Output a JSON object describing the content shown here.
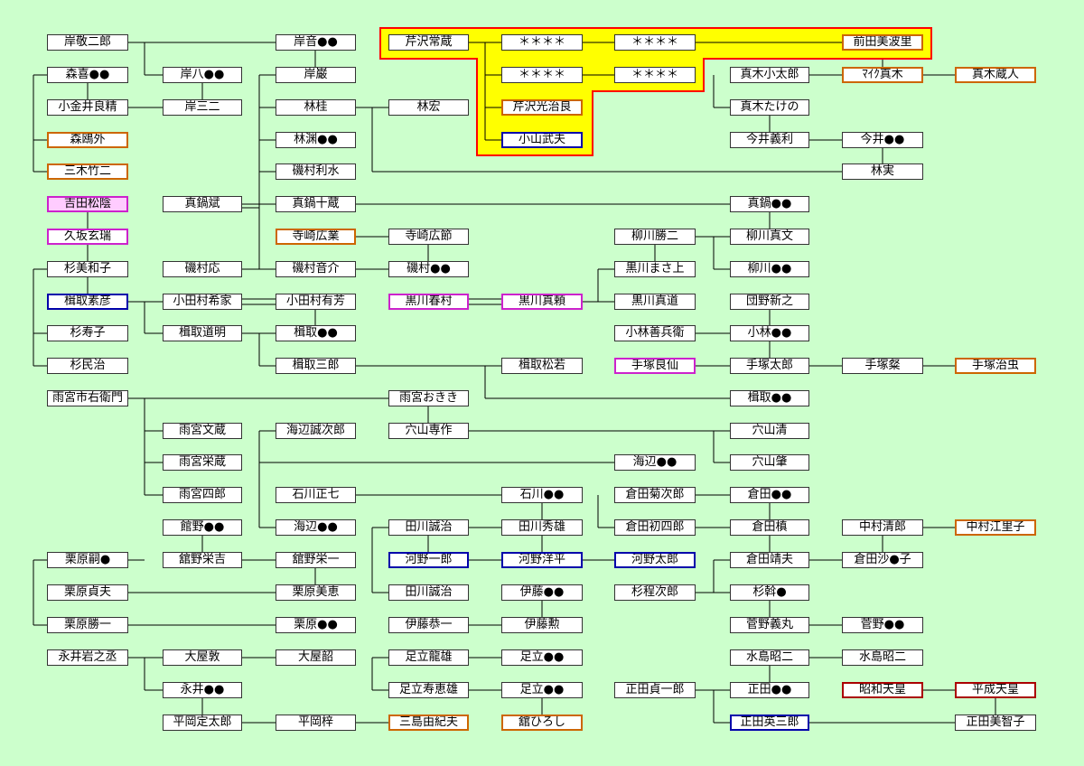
{
  "colors": {
    "background": "#ccffcc",
    "highlight_fill": "#ffff00",
    "highlight_border": "#ff0000",
    "orange_border": "#cc6600",
    "blue_border": "#0000aa",
    "pink_border": "#cc22cc",
    "red_border": "#aa0000",
    "pink_fill": "#ffccff"
  },
  "people": {
    "kishi_keijiro": "岸敬二郎",
    "kishi_a": "岸音●●",
    "kishi_gan": "岸巌",
    "kishi_hachi": "岸八●●",
    "kishi_sanji": "岸三二",
    "mori_ki": "森喜●●",
    "kogai_yoshikiyo": "小金井良精",
    "mori_ogai": "森鴎外",
    "miki_takeji": "三木竹二",
    "yoshida_shoin": "吉田松陰",
    "kusaka_genzui": "久坂玄瑞",
    "sugi_miwako": "杉美和子",
    "katori_motohiko": "楫取素彦",
    "sugi_hisako": "杉寿子",
    "sugi_minji": "杉民治",
    "odamura_kiyoie": "小田村希家",
    "katori_doumei": "楫取道明",
    "manabe_takeshi": "真鍋斌",
    "isomura_o": "磯村応",
    "hayashi_kei": "林桂",
    "hayashi_hiroshi": "林宏",
    "hayashi_x": "林渊●●",
    "isomura_risui": "磯村利水",
    "manabe_jyuzo": "真鍋十蔵",
    "terasaki_hironari": "寺崎広業",
    "terasaki_hirosetsu": "寺崎広節",
    "isomura_onsuke": "磯村音介",
    "isomura_x": "磯村●●",
    "odamura_arichika": "小田村有芳",
    "katori_x": "楫取●●",
    "katori_saburo": "楫取三郎",
    "serizawa_tsunezo": "芹沢常蔵",
    "stars": "＊＊＊＊",
    "maeda_minori": "前田美波里",
    "serizawa_mitsuharu": "芹沢光治良",
    "koyama_takeo": "小山武夫",
    "maki_kotaro": "真木小太郎",
    "mike_maki": "ﾏｲｸ真木",
    "maki_kurando": "真木蔵人",
    "maki_takeno": "真木たけの",
    "imai_yoshitoshi": "今井義利",
    "imai_x": "今井●●",
    "hayashi_minoru": "林実",
    "manabe_x": "真鍋●●",
    "yanagawa_katsuji": "柳川勝二",
    "yanagawa_masafumi": "柳川真文",
    "kurokawa_x": "黒川まさ上",
    "yanagawa_x": "柳川●●",
    "kurokawa_harumura": "黒川春村",
    "kurokawa_masayori": "黒川真頼",
    "kurokawa_mamichi": "黒川真道",
    "danno_shinnosuke": "団野新之",
    "kobayashi_zenbee": "小林善兵衛",
    "kobayashi_x": "小林●●",
    "tezuka_ryosen": "手塚良仙",
    "tezuka_taro": "手塚太郎",
    "tezuka_yutaka": "手塚粲",
    "tezuka_osamu": "手塚治虫",
    "katori_matsuwaka": "楫取松若",
    "katori_y": "楫取●●",
    "amamiya_ichiuemon": "雨宮市右衛門",
    "amamiya_ok": "雨宮おきき",
    "amamiya_bunzo": "雨宮文蔵",
    "amamiya_eizo": "雨宮栄蔵",
    "amamiya_shiro": "雨宮四郎",
    "unabe_seijiro": "海辺誠次郎",
    "anayama_sensaku": "穴山専作",
    "anayama_kiyoshi": "穴山清",
    "unabe_x": "海辺●●",
    "anayama_hajime": "穴山肇",
    "ishikawa_masashichi": "石川正七",
    "ishikawa_x": "石川●●",
    "kurata_kikujiro": "倉田菊次郎",
    "kurata_x": "倉田●●",
    "tateno_x": "館野●●",
    "unabe_y": "海辺●●",
    "tagawa_seiji": "田川誠治",
    "tagawa_hideo": "田川秀雄",
    "kurata_hatsushiro": "倉田初四郎",
    "kurata_shin": "倉田槙",
    "nakamura_kiyoshiro": "中村清郎",
    "nakamura_eriko": "中村江里子",
    "kurihara_x": "栗原嗣●",
    "tateno_eikichi": "舘野栄吉",
    "tateno_eiichi": "舘野栄一",
    "kono_ichiro": "河野一郎",
    "kono_yohei": "河野洋平",
    "kono_taro": "河野太郎",
    "kurata_yasuo": "倉田靖夫",
    "kurata_y": "倉田沙●子",
    "kurihara_sadao": "栗原貞夫",
    "kurihara_mie": "栗原美恵",
    "tagawa_seiji2": "田川誠治",
    "ito_x": "伊藤●●",
    "sugi_teijiro": "杉程次郎",
    "sugi_x": "杉斡●",
    "kurihara_katsuichi": "栗原勝一",
    "kurihara_y": "栗原●●",
    "ito_kyoichi": "伊藤恭一",
    "ito_isao": "伊藤勲",
    "sugano_yoshimaru": "菅野義丸",
    "sugano_x": "菅野●●",
    "nagai_iwanojo": "永井岩之丞",
    "oya_atsushi": "大屋敦",
    "oya_akira": "大屋韶",
    "adachi_tatsuo": "足立龍雄",
    "adachi_x": "足立●●",
    "mizushima_shoji": "水島昭二",
    "mizushima_shoji2": "水島昭二",
    "nagai_x": "永井●●",
    "adachi_toshieo": "足立寿恵雄",
    "adachi_y": "足立●●",
    "shoda_teiichiro": "正田貞一郎",
    "shoda_x": "正田●●",
    "showa_tenno": "昭和天皇",
    "heisei_tenno": "平成天皇",
    "hiraoka_sadataro": "平岡定太郎",
    "hiraoka_azusa": "平岡梓",
    "mishima_yukio": "三島由紀夫",
    "tate_hiroshi": "舘ひろし",
    "shoda_hidesaburo": "正田英三郎",
    "shoda_michiko": "正田美智子"
  }
}
